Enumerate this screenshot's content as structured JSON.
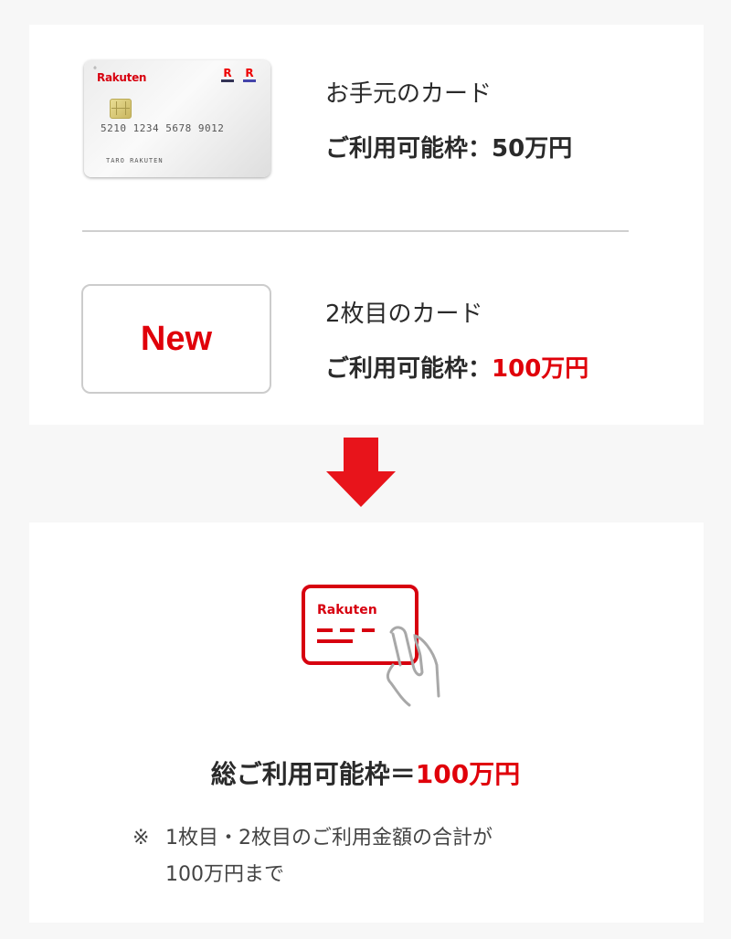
{
  "colors": {
    "accent": "#e0000a",
    "text": "#2a2a2a",
    "background": "#f7f7f7",
    "panel": "#ffffff",
    "divider": "#cfcfcf"
  },
  "current_card": {
    "card_image": {
      "brand": "Rakuten",
      "number": "5210 1234 5678 9012",
      "holder": "TARO RAKUTEN",
      "icon": "credit-card-icon"
    },
    "label": "お手元のカード",
    "limit_prefix": "ご利用可能枠：",
    "limit_value": "50万円"
  },
  "second_card": {
    "badge": "New",
    "label": "2枚目のカード",
    "limit_prefix": "ご利用可能枠：",
    "limit_value": "100万円"
  },
  "arrow": {
    "icon": "arrow-down-icon"
  },
  "result": {
    "illustration": {
      "brand": "Rakuten",
      "icon": "hand-holding-card-icon"
    },
    "total_prefix": "総ご利用可能枠＝",
    "total_value": "100万円",
    "note_mark": "※",
    "note_line1": "1枚目・2枚目のご利用金額の合計が",
    "note_line2": "100万円まで"
  }
}
